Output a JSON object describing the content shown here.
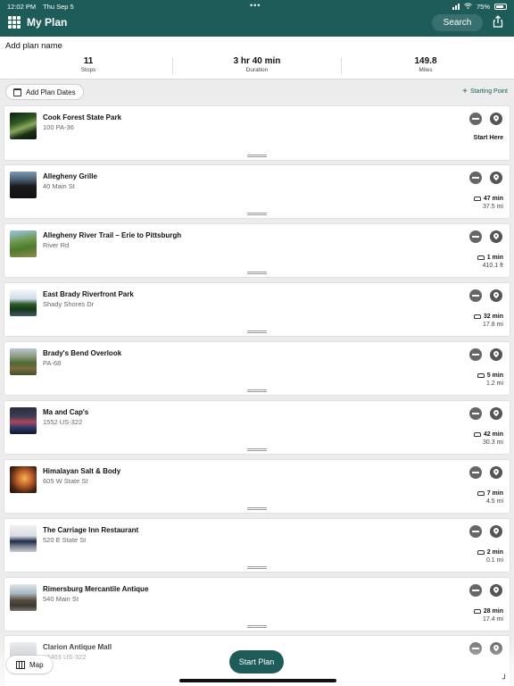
{
  "status_bar": {
    "time": "12:02 PM",
    "date": "Thu Sep 5",
    "battery": "75%"
  },
  "nav": {
    "title": "My Plan",
    "search_label": "Search",
    "menu_icon": "grid-icon",
    "share_icon": "share-icon"
  },
  "plan": {
    "name": "Add plan name",
    "stats": [
      {
        "value": "11",
        "label": "Stops"
      },
      {
        "value": "3 hr 40 min",
        "label": "Duration"
      },
      {
        "value": "149.8",
        "label": "Miles"
      }
    ],
    "add_dates_label": "Add Plan Dates",
    "starting_point_label": "Starting Point"
  },
  "stops": [
    {
      "name": "Cook Forest State Park",
      "address": "100 PA-36",
      "start_label": "Start Here"
    },
    {
      "name": "Allegheny Grille",
      "address": "40 Main St",
      "time": "47 min",
      "distance": "37.5 mi"
    },
    {
      "name": "Allegheny River Trail – Erie to Pittsburgh",
      "address": "River Rd",
      "time": "1 min",
      "distance": "410.1 ft"
    },
    {
      "name": "East Brady Riverfront Park",
      "address": "Shady Shores Dr",
      "time": "32 min",
      "distance": "17.8 mi"
    },
    {
      "name": "Brady's Bend Overlook",
      "address": "PA-68",
      "time": "5 min",
      "distance": "1.2 mi"
    },
    {
      "name": "Ma and Cap's",
      "address": "1552 US-322",
      "time": "42 min",
      "distance": "30.3 mi"
    },
    {
      "name": "Himalayan Salt & Body",
      "address": "605 W State St",
      "time": "7 min",
      "distance": "4.5 mi"
    },
    {
      "name": "The Carriage Inn Restaurant",
      "address": "520 E State St",
      "time": "2 min",
      "distance": "0.1 mi"
    },
    {
      "name": "Rimersburg Mercantile Antique",
      "address": "540 Main St",
      "time": "28 min",
      "distance": "17.4 mi"
    },
    {
      "name": "Clarion Antique Mall",
      "address": "10403 US-322"
    }
  ],
  "footer": {
    "map_label": "Map",
    "start_plan_label": "Start Plan"
  },
  "colors": {
    "brand": "#1e5c59",
    "background": "#ececec",
    "card": "#ffffff"
  }
}
